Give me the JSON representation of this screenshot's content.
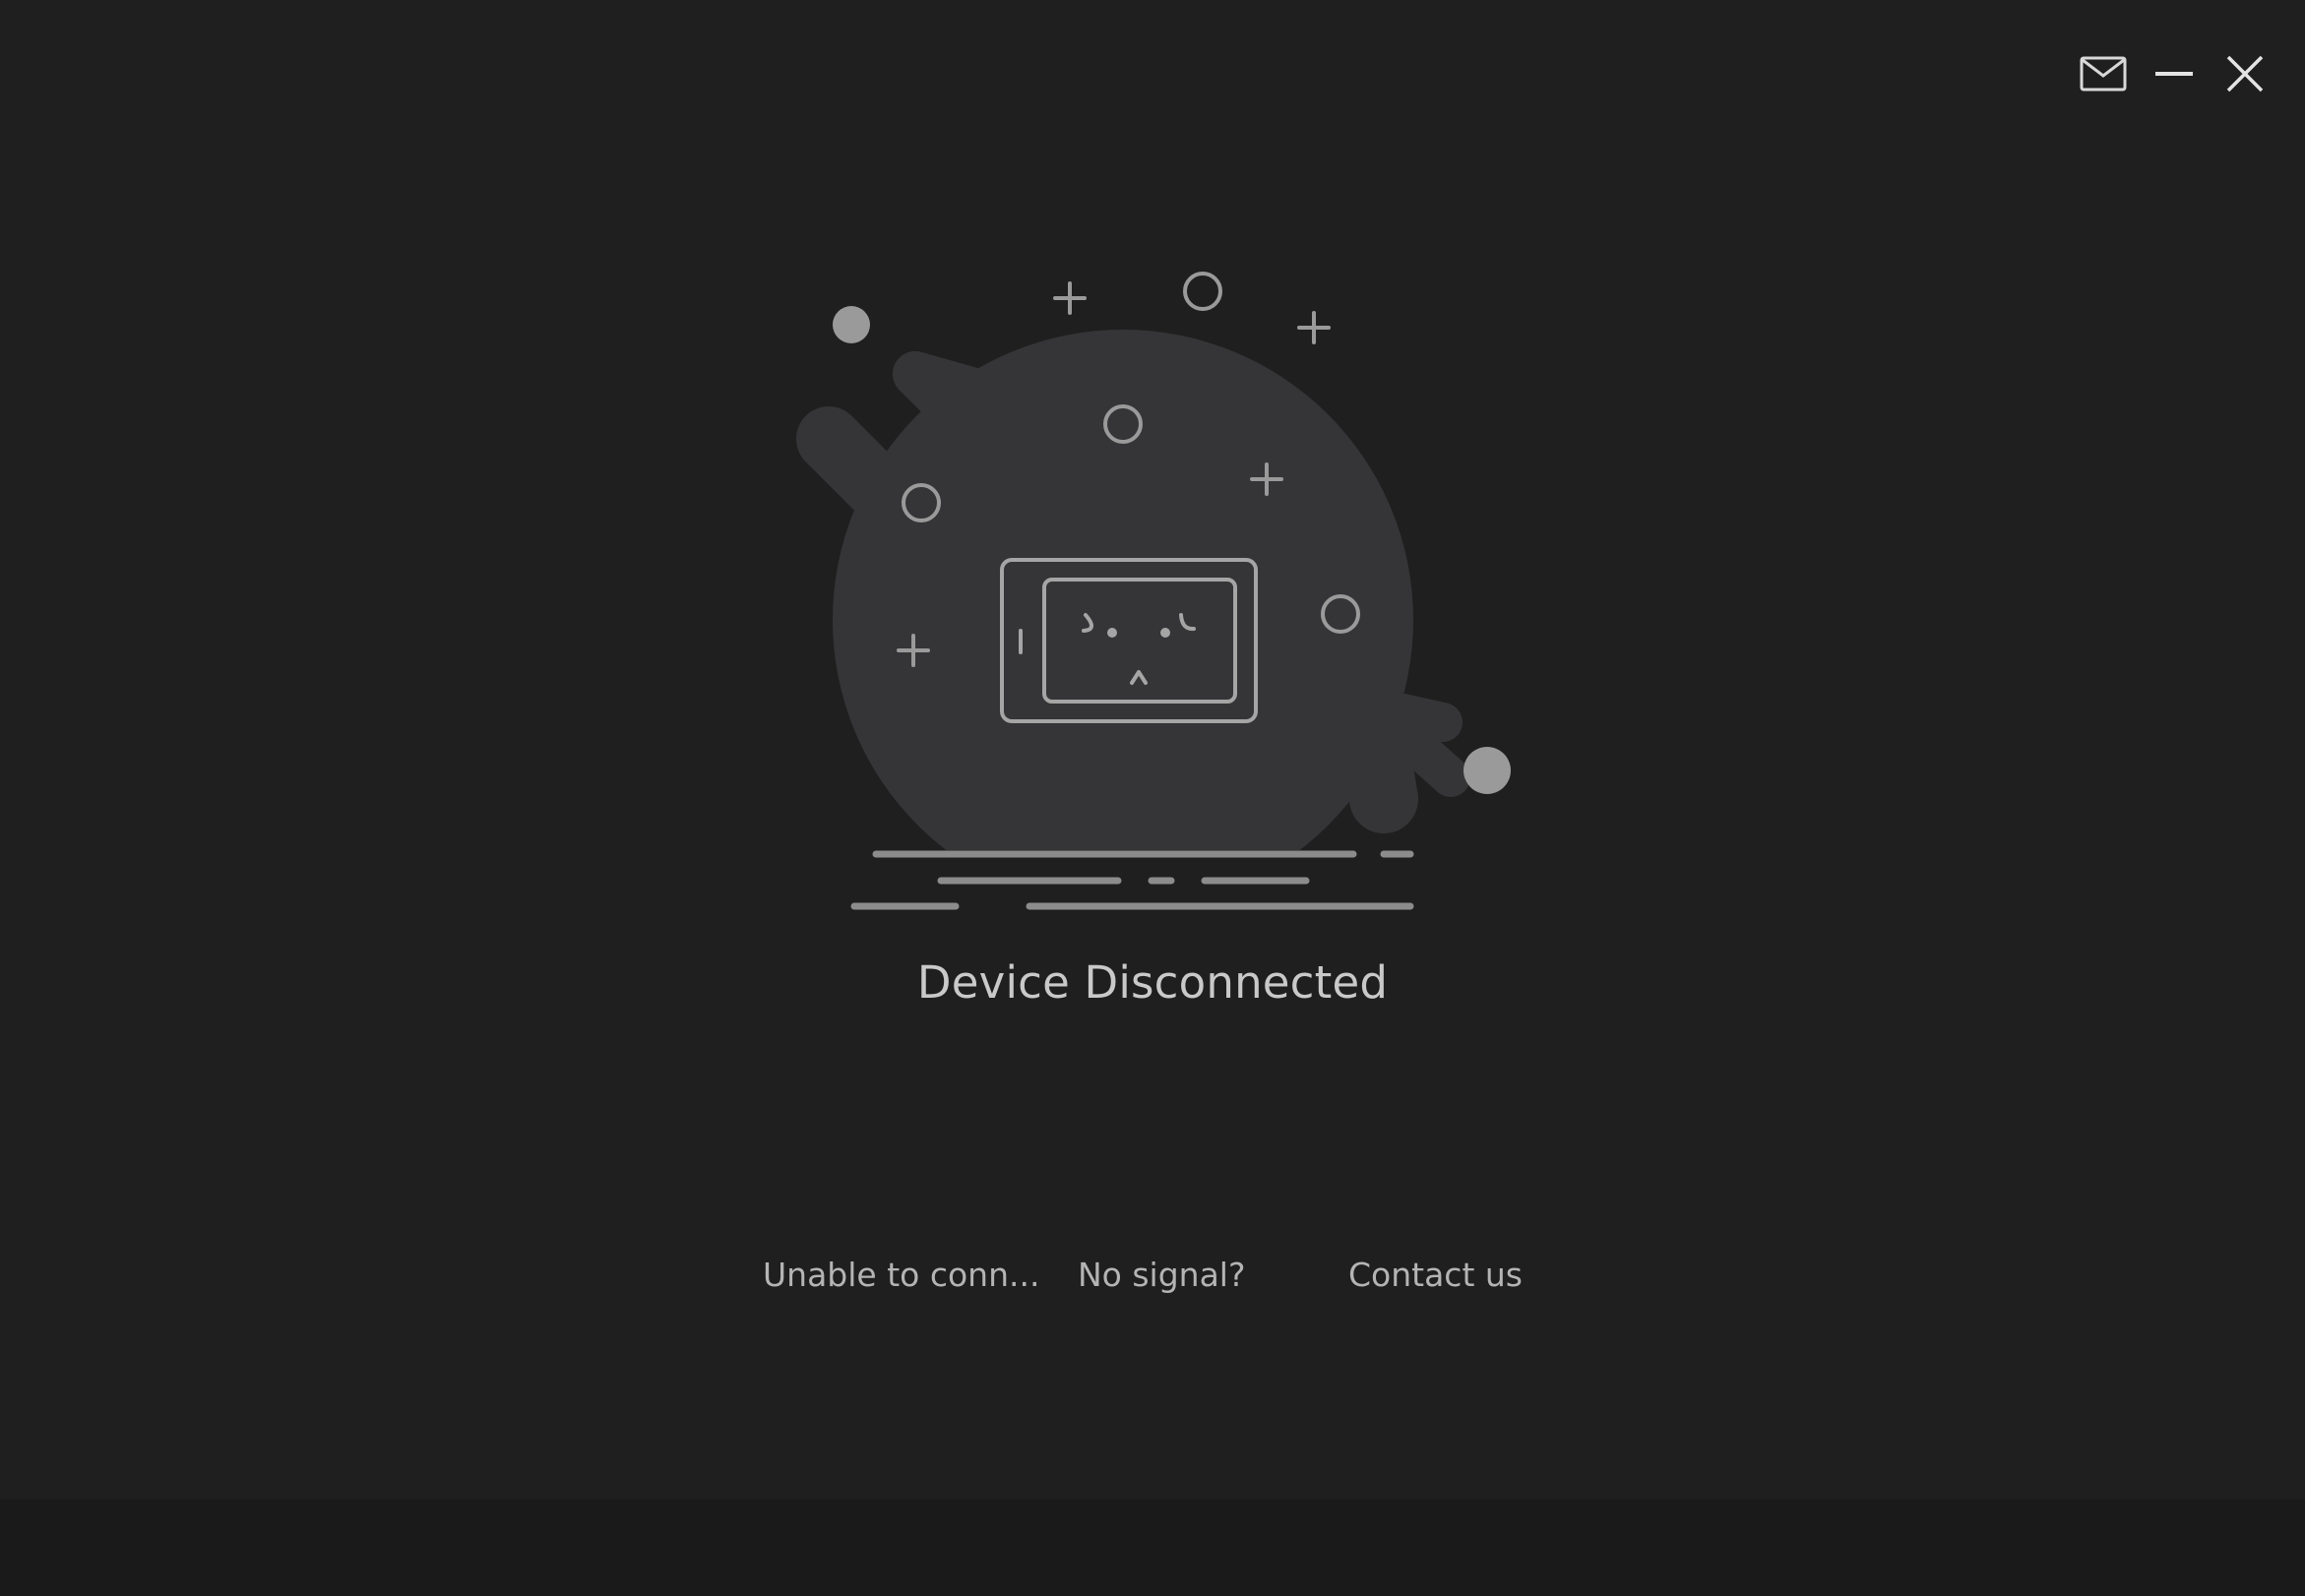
{
  "window": {
    "controls": {
      "mail_icon": "mail-icon",
      "minimize_icon": "minimize-icon",
      "close_icon": "close-icon"
    }
  },
  "status": {
    "title": "Device Disconnected"
  },
  "help_links": {
    "unable_to_connect": "Unable to conn...",
    "no_signal": "No signal?",
    "contact_us": "Contact us"
  },
  "colors": {
    "background": "#1f1f1f",
    "footer": "#1a1a1a",
    "blob": "#353537",
    "line_art": "#9a9a9a",
    "title_text": "#c9c9c9",
    "link_text": "#b4b4b4"
  }
}
